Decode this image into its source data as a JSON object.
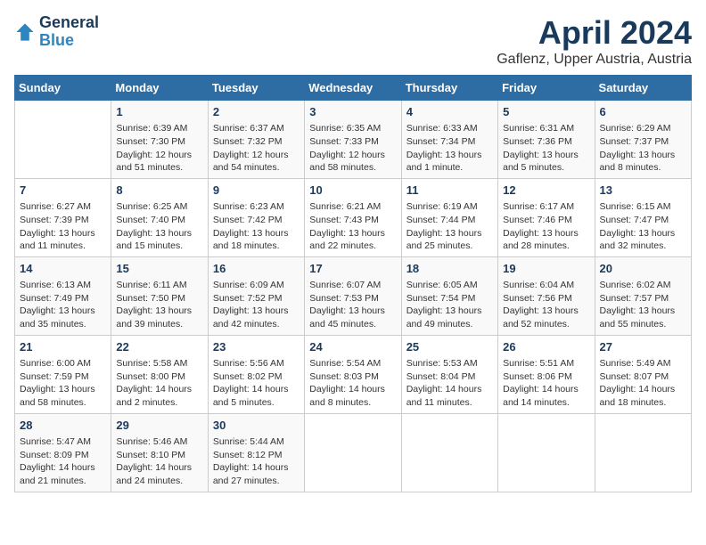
{
  "header": {
    "logo_line1": "General",
    "logo_line2": "Blue",
    "month": "April 2024",
    "location": "Gaflenz, Upper Austria, Austria"
  },
  "weekdays": [
    "Sunday",
    "Monday",
    "Tuesday",
    "Wednesday",
    "Thursday",
    "Friday",
    "Saturday"
  ],
  "weeks": [
    [
      {
        "day": "",
        "info": ""
      },
      {
        "day": "1",
        "info": "Sunrise: 6:39 AM\nSunset: 7:30 PM\nDaylight: 12 hours\nand 51 minutes."
      },
      {
        "day": "2",
        "info": "Sunrise: 6:37 AM\nSunset: 7:32 PM\nDaylight: 12 hours\nand 54 minutes."
      },
      {
        "day": "3",
        "info": "Sunrise: 6:35 AM\nSunset: 7:33 PM\nDaylight: 12 hours\nand 58 minutes."
      },
      {
        "day": "4",
        "info": "Sunrise: 6:33 AM\nSunset: 7:34 PM\nDaylight: 13 hours\nand 1 minute."
      },
      {
        "day": "5",
        "info": "Sunrise: 6:31 AM\nSunset: 7:36 PM\nDaylight: 13 hours\nand 5 minutes."
      },
      {
        "day": "6",
        "info": "Sunrise: 6:29 AM\nSunset: 7:37 PM\nDaylight: 13 hours\nand 8 minutes."
      }
    ],
    [
      {
        "day": "7",
        "info": "Sunrise: 6:27 AM\nSunset: 7:39 PM\nDaylight: 13 hours\nand 11 minutes."
      },
      {
        "day": "8",
        "info": "Sunrise: 6:25 AM\nSunset: 7:40 PM\nDaylight: 13 hours\nand 15 minutes."
      },
      {
        "day": "9",
        "info": "Sunrise: 6:23 AM\nSunset: 7:42 PM\nDaylight: 13 hours\nand 18 minutes."
      },
      {
        "day": "10",
        "info": "Sunrise: 6:21 AM\nSunset: 7:43 PM\nDaylight: 13 hours\nand 22 minutes."
      },
      {
        "day": "11",
        "info": "Sunrise: 6:19 AM\nSunset: 7:44 PM\nDaylight: 13 hours\nand 25 minutes."
      },
      {
        "day": "12",
        "info": "Sunrise: 6:17 AM\nSunset: 7:46 PM\nDaylight: 13 hours\nand 28 minutes."
      },
      {
        "day": "13",
        "info": "Sunrise: 6:15 AM\nSunset: 7:47 PM\nDaylight: 13 hours\nand 32 minutes."
      }
    ],
    [
      {
        "day": "14",
        "info": "Sunrise: 6:13 AM\nSunset: 7:49 PM\nDaylight: 13 hours\nand 35 minutes."
      },
      {
        "day": "15",
        "info": "Sunrise: 6:11 AM\nSunset: 7:50 PM\nDaylight: 13 hours\nand 39 minutes."
      },
      {
        "day": "16",
        "info": "Sunrise: 6:09 AM\nSunset: 7:52 PM\nDaylight: 13 hours\nand 42 minutes."
      },
      {
        "day": "17",
        "info": "Sunrise: 6:07 AM\nSunset: 7:53 PM\nDaylight: 13 hours\nand 45 minutes."
      },
      {
        "day": "18",
        "info": "Sunrise: 6:05 AM\nSunset: 7:54 PM\nDaylight: 13 hours\nand 49 minutes."
      },
      {
        "day": "19",
        "info": "Sunrise: 6:04 AM\nSunset: 7:56 PM\nDaylight: 13 hours\nand 52 minutes."
      },
      {
        "day": "20",
        "info": "Sunrise: 6:02 AM\nSunset: 7:57 PM\nDaylight: 13 hours\nand 55 minutes."
      }
    ],
    [
      {
        "day": "21",
        "info": "Sunrise: 6:00 AM\nSunset: 7:59 PM\nDaylight: 13 hours\nand 58 minutes."
      },
      {
        "day": "22",
        "info": "Sunrise: 5:58 AM\nSunset: 8:00 PM\nDaylight: 14 hours\nand 2 minutes."
      },
      {
        "day": "23",
        "info": "Sunrise: 5:56 AM\nSunset: 8:02 PM\nDaylight: 14 hours\nand 5 minutes."
      },
      {
        "day": "24",
        "info": "Sunrise: 5:54 AM\nSunset: 8:03 PM\nDaylight: 14 hours\nand 8 minutes."
      },
      {
        "day": "25",
        "info": "Sunrise: 5:53 AM\nSunset: 8:04 PM\nDaylight: 14 hours\nand 11 minutes."
      },
      {
        "day": "26",
        "info": "Sunrise: 5:51 AM\nSunset: 8:06 PM\nDaylight: 14 hours\nand 14 minutes."
      },
      {
        "day": "27",
        "info": "Sunrise: 5:49 AM\nSunset: 8:07 PM\nDaylight: 14 hours\nand 18 minutes."
      }
    ],
    [
      {
        "day": "28",
        "info": "Sunrise: 5:47 AM\nSunset: 8:09 PM\nDaylight: 14 hours\nand 21 minutes."
      },
      {
        "day": "29",
        "info": "Sunrise: 5:46 AM\nSunset: 8:10 PM\nDaylight: 14 hours\nand 24 minutes."
      },
      {
        "day": "30",
        "info": "Sunrise: 5:44 AM\nSunset: 8:12 PM\nDaylight: 14 hours\nand 27 minutes."
      },
      {
        "day": "",
        "info": ""
      },
      {
        "day": "",
        "info": ""
      },
      {
        "day": "",
        "info": ""
      },
      {
        "day": "",
        "info": ""
      }
    ]
  ]
}
